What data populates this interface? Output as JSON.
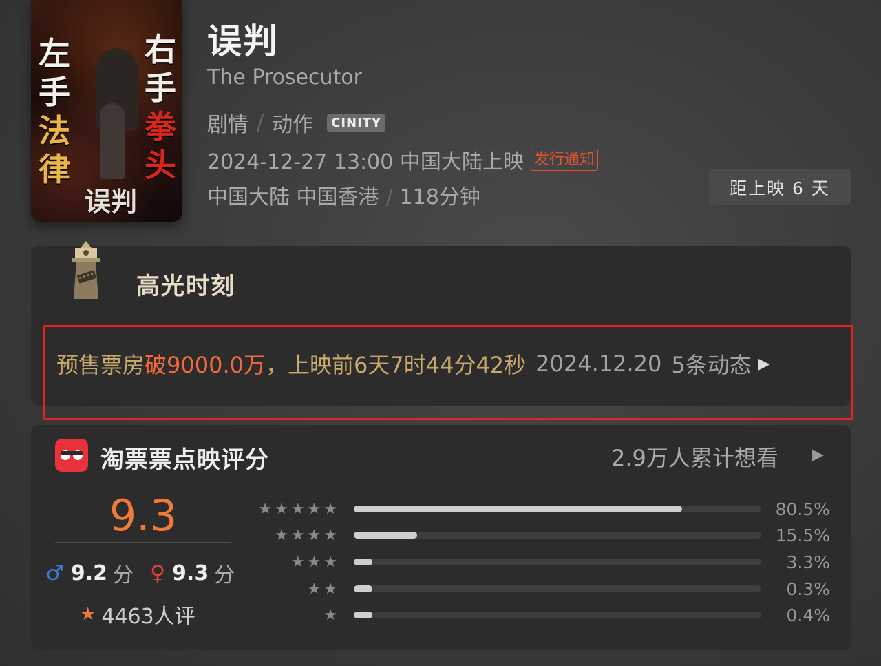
{
  "poster": {
    "left_text": [
      "左",
      "手",
      "法",
      "律"
    ],
    "right_text": [
      "右",
      "手",
      "拳",
      "头"
    ],
    "title": "误判"
  },
  "movie": {
    "title_cn": "误判",
    "title_en": "The Prosecutor",
    "genres": [
      "剧情",
      "动作"
    ],
    "format_badge": "CINITY",
    "release": "2024-12-27 13:00 中国大陆上映",
    "notify_label": "发行通知",
    "regions": "中国大陆 中国香港",
    "duration": "118分钟",
    "countdown": "距上映 6 天"
  },
  "highlight": {
    "title": "高光时刻",
    "presale_label": "预售票房 ",
    "presale_value": "破9000.0万",
    "presale_mid": "，上映前6天7时44分42秒",
    "date": "2024.12.20",
    "updates": "5条动态"
  },
  "rating": {
    "title": "淘票票点映评分",
    "want": "2.9万人累计想看",
    "score": "9.3",
    "male_score": "9.2",
    "female_score": "9.3",
    "score_unit": "分",
    "reviews": "4463人评",
    "distribution": [
      {
        "stars": "★★★★★",
        "percent": 80.5,
        "label": "80.5%"
      },
      {
        "stars": "★★★★",
        "percent": 15.5,
        "label": "15.5%"
      },
      {
        "stars": "★★★",
        "percent": 3.3,
        "label": "3.3%"
      },
      {
        "stars": "★★",
        "percent": 0.3,
        "label": "0.3%"
      },
      {
        "stars": "★",
        "percent": 0.4,
        "label": "0.4%"
      }
    ]
  },
  "colors": {
    "accent_orange": "#ef7b3a",
    "highlight_border": "#e02420",
    "presale_gold": "#c9a86a",
    "male_blue": "#3a7bd5",
    "female_red": "#e2413c"
  },
  "icons": [
    "lighthouse-icon",
    "taopiaopiao-logo-icon",
    "male-icon",
    "female-icon",
    "star-icon",
    "play-arrow-icon"
  ]
}
